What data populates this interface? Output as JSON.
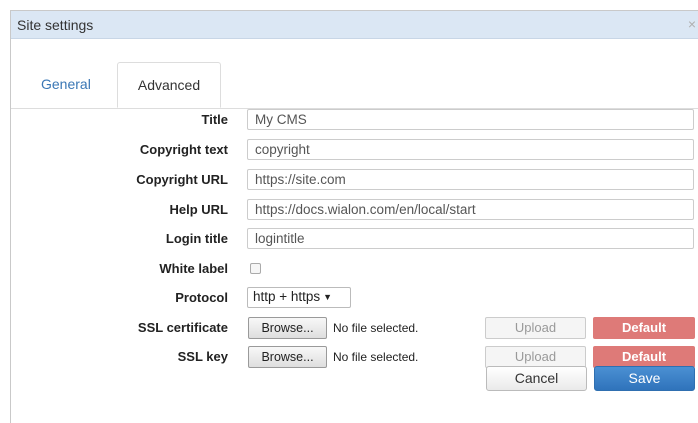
{
  "window": {
    "title": "Site settings",
    "close_glyph": "×"
  },
  "tabs": [
    {
      "label": "General",
      "active": false
    },
    {
      "label": "Advanced",
      "active": true
    }
  ],
  "fields": {
    "title": {
      "label": "Title",
      "value": "My CMS"
    },
    "copyright_text": {
      "label": "Copyright text",
      "value": "copyright"
    },
    "copyright_url": {
      "label": "Copyright URL",
      "value": "https://site.com"
    },
    "help_url": {
      "label": "Help URL",
      "value": "https://docs.wialon.com/en/local/start"
    },
    "login_title": {
      "label": "Login title",
      "value": "logintitle"
    },
    "white_label": {
      "label": "White label",
      "checked": false
    },
    "protocol": {
      "label": "Protocol",
      "selected": "http + https",
      "arrow": "▼"
    },
    "ssl_certificate": {
      "label": "SSL certificate",
      "browse": "Browse...",
      "file_status": "No file selected.",
      "upload": "Upload",
      "default": "Default"
    },
    "ssl_key": {
      "label": "SSL key",
      "browse": "Browse...",
      "file_status": "No file selected.",
      "upload": "Upload",
      "default": "Default"
    }
  },
  "footer": {
    "cancel": "Cancel",
    "save": "Save"
  },
  "colors": {
    "titlebar": "#dbe7f4",
    "save": "#3a7fc4",
    "default": "#de7a78",
    "tab_link": "#3a77b5"
  }
}
